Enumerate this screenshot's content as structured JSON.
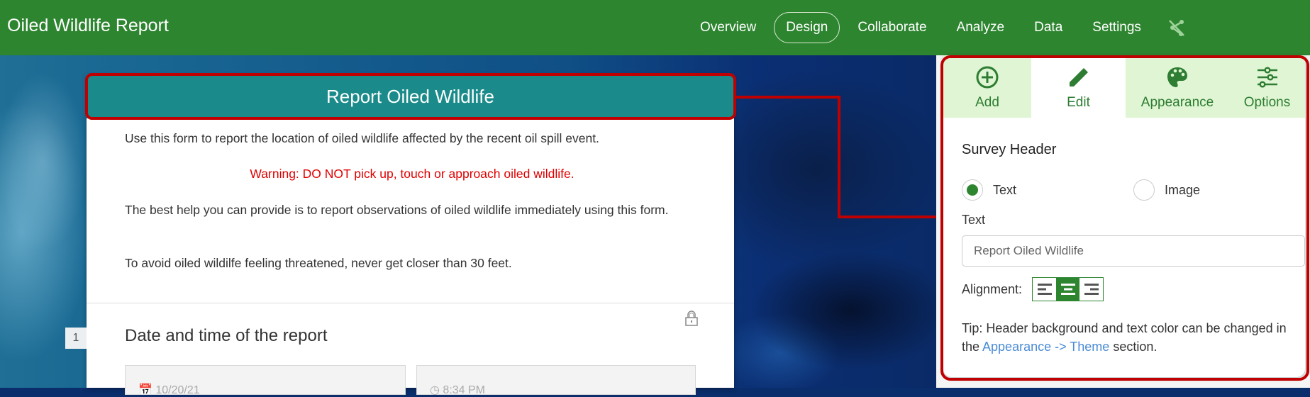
{
  "app": {
    "title": "Oiled Wildlife Report"
  },
  "nav": {
    "items": [
      {
        "label": "Overview"
      },
      {
        "label": "Design",
        "active": true
      },
      {
        "label": "Collaborate"
      },
      {
        "label": "Analyze"
      },
      {
        "label": "Data"
      },
      {
        "label": "Settings"
      }
    ],
    "extra_icon": "share-off-icon"
  },
  "form": {
    "header": "Report Oiled Wildlife",
    "intro_1": "Use this form to report the location of oiled wildlife affected by the recent oil spill event.",
    "warning": "Warning: DO NOT pick up, touch or approach oiled wildlife.",
    "intro_2": "The best help you can provide is to report observations of oiled wildlife immediately using this form.",
    "intro_3": "To avoid oiled wildilfe feeling threatened, never get closer than 30 feet.",
    "question": {
      "number": "1",
      "title": "Date and time of the report",
      "date_value": "10/20/21",
      "time_value": "8:34 PM"
    }
  },
  "panel": {
    "tabs": [
      {
        "label": "Add",
        "icon": "add-circle-icon"
      },
      {
        "label": "Edit",
        "icon": "pencil-icon",
        "active": true
      },
      {
        "label": "Appearance",
        "icon": "palette-icon"
      },
      {
        "label": "Options",
        "icon": "sliders-icon"
      }
    ],
    "section_title": "Survey Header",
    "header_type": {
      "options": [
        {
          "label": "Text",
          "selected": true
        },
        {
          "label": "Image",
          "selected": false
        }
      ]
    },
    "text_label": "Text",
    "text_value": "Report Oiled Wildlife",
    "alignment_label": "Alignment:",
    "alignment_selected": "center",
    "tip_prefix": "Tip: Header background and text color can be changed in the ",
    "tip_link": "Appearance -> Theme",
    "tip_suffix": " section."
  },
  "colors": {
    "brand_green": "#2e8530",
    "header_teal": "#1a8a8a",
    "highlight_red": "#c00000",
    "warning_red": "#e00000",
    "tab_bg": "#dff5d3",
    "link_blue": "#4a8bd6"
  }
}
